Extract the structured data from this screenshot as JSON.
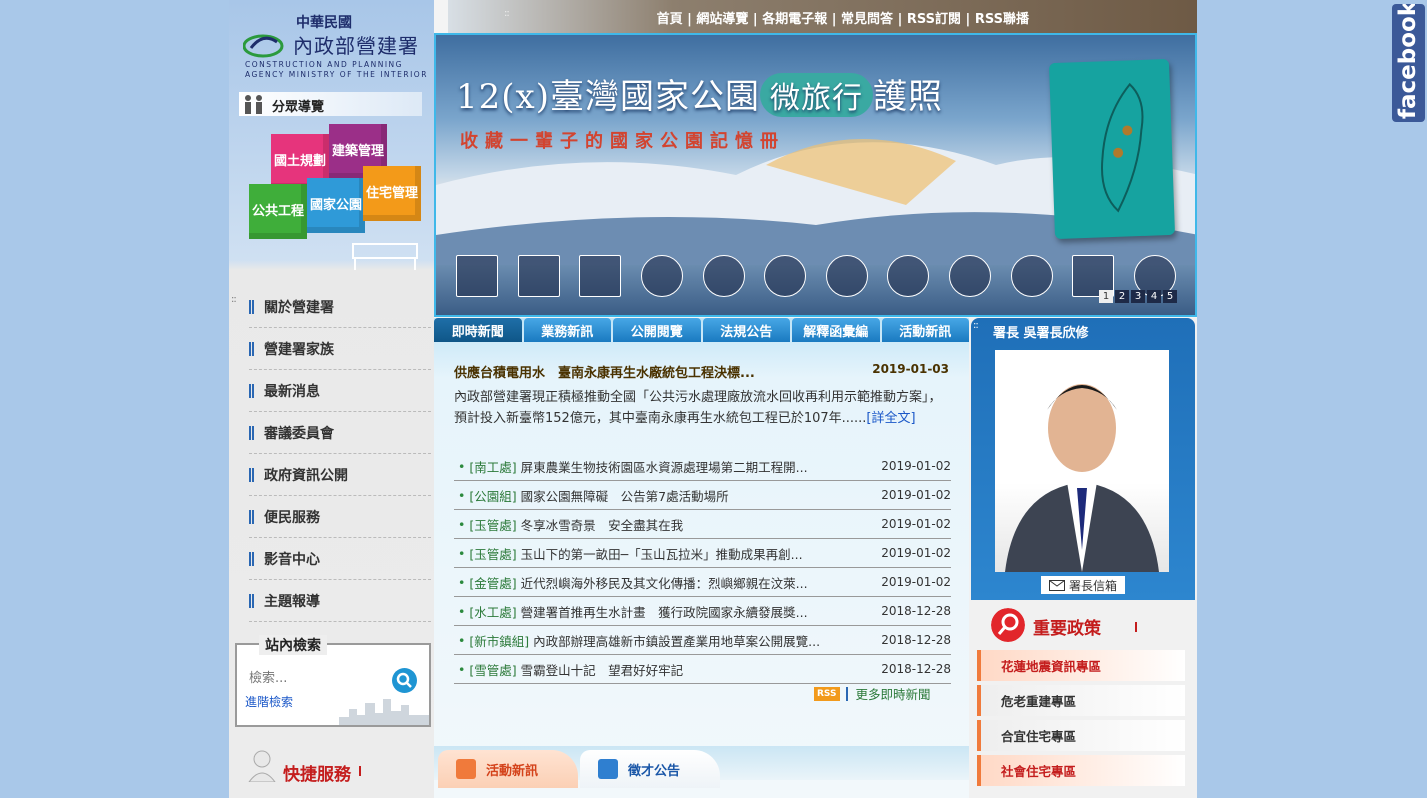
{
  "logo": {
    "cn_small": "中華民國",
    "cn_big": "內政部營建署",
    "en_line1": "CONSTRUCTION AND PLANNING",
    "en_line2": "AGENCY MINISTRY OF THE INTERIOR"
  },
  "guide": {
    "label": "分眾導覽"
  },
  "cubes": [
    {
      "label": "國土規劃",
      "color": "#e6347c"
    },
    {
      "label": "建築管理",
      "color": "#9b2f88"
    },
    {
      "label": "公共工程",
      "color": "#3fae3a"
    },
    {
      "label": "國家公園",
      "color": "#2f9ad8"
    },
    {
      "label": "住宅管理",
      "color": "#f39a19"
    }
  ],
  "menu": [
    "關於營建署",
    "營建署家族",
    "最新消息",
    "審議委員會",
    "政府資訊公開",
    "便民服務",
    "影音中心",
    "主題報導"
  ],
  "search": {
    "legend": "站內檢索",
    "placeholder": "檢索...",
    "advanced": "進階檢索"
  },
  "quick": {
    "label": "快捷服務"
  },
  "topnav": [
    "首頁",
    "網站導覽",
    "各期電子報",
    "常見問答",
    "RSS訂閱",
    "RSS聯播"
  ],
  "banner": {
    "title_prefix": "12(x)臺灣國家公園",
    "title_pill": "微旅行",
    "title_suffix": "護照",
    "subtitle": "收藏一輩子的國家公園記憶冊",
    "pages": [
      "1",
      "2",
      "3",
      "4",
      "5"
    ]
  },
  "tabs": [
    "即時新聞",
    "業務新訊",
    "公開閱覽",
    "法規公告",
    "解釋函彙編",
    "活動新訊"
  ],
  "headline": {
    "title": "供應台積電用水　臺南永康再生水廠統包工程決標...",
    "date": "2019-01-03",
    "body": "內政部營建署現正積極推動全國「公共污水處理廠放流水回收再利用示範推動方案」，預計投入新臺幣152億元，其中臺南永康再生水統包工程已於107年......",
    "more": "[詳全文]"
  },
  "news": [
    {
      "cat": "[南工處]",
      "title": "屏東農業生物技術園區水資源處理場第二期工程開...",
      "date": "2019-01-02"
    },
    {
      "cat": "[公園組]",
      "title": "國家公園無障礙　公告第7處活動場所",
      "date": "2019-01-02"
    },
    {
      "cat": "[玉管處]",
      "title": "冬享冰雪奇景　安全盡其在我",
      "date": "2019-01-02"
    },
    {
      "cat": "[玉管處]",
      "title": "玉山下的第一畝田─「玉山瓦拉米」推動成果再創...",
      "date": "2019-01-02"
    },
    {
      "cat": "[金管處]",
      "title": "近代烈嶼海外移民及其文化傳播：烈嶼鄉親在汶萊...",
      "date": "2019-01-02"
    },
    {
      "cat": "[水工處]",
      "title": "營建署首推再生水計畫　獲行政院國家永續發展獎...",
      "date": "2018-12-28"
    },
    {
      "cat": "[新市鎮組]",
      "title": "內政部辦理高雄新市鎮設置產業用地草案公開展覽...",
      "date": "2018-12-28"
    },
    {
      "cat": "[雪管處]",
      "title": "雪霸登山十記　望君好好牢記",
      "date": "2018-12-28"
    }
  ],
  "rss": {
    "badge": "RSS",
    "more": "更多即時新聞"
  },
  "lowtabs": [
    "活動新訊",
    "徵才公告"
  ],
  "director": {
    "title": "署長 吳署長欣修",
    "mailbox": "署長信箱"
  },
  "policy": {
    "title": "重要政策"
  },
  "policy_links": [
    {
      "label": "花蓮地震資訊專區",
      "color": "#c41d1d"
    },
    {
      "label": "危老重建專區",
      "color": "#333333"
    },
    {
      "label": "合宜住宅專區",
      "color": "#333333"
    },
    {
      "label": "社會住宅專區",
      "color": "#c41d1d"
    }
  ],
  "facebook": {
    "label": "facebook"
  }
}
